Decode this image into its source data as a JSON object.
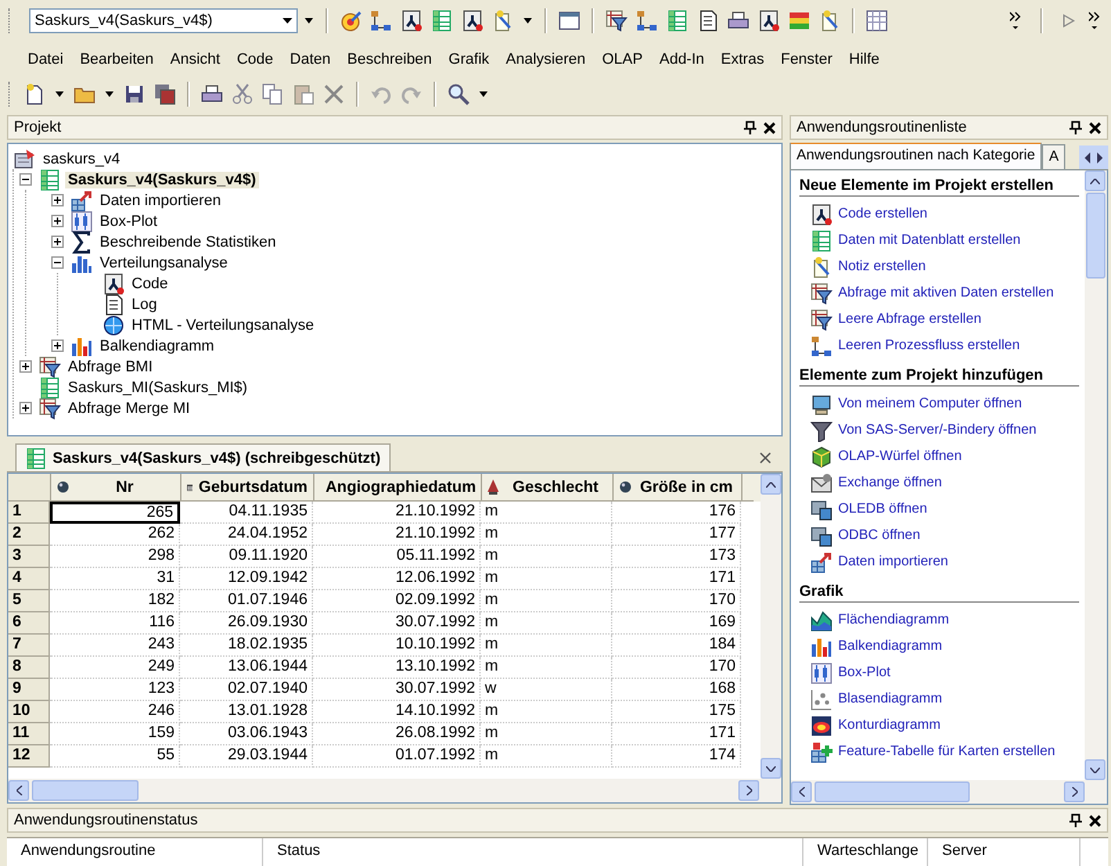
{
  "toolbar": {
    "dataset_selector": "Saskurs_v4(Saskurs_v4$)"
  },
  "menu": [
    "Datei",
    "Bearbeiten",
    "Ansicht",
    "Code",
    "Daten",
    "Beschreiben",
    "Grafik",
    "Analysieren",
    "OLAP",
    "Add-In",
    "Extras",
    "Fenster",
    "Hilfe"
  ],
  "project_panel": {
    "title": "Projekt",
    "tree": [
      {
        "label": "saskurs_v4",
        "kind": "project",
        "selected": false,
        "children": [
          {
            "label": "Saskurs_v4(Saskurs_v4$)",
            "kind": "data",
            "expanded": true,
            "selected": true,
            "children": [
              {
                "label": "Daten importieren",
                "kind": "import",
                "expanded": false,
                "selected": false
              },
              {
                "label": "Box-Plot",
                "kind": "boxplot",
                "expanded": false,
                "selected": false
              },
              {
                "label": "Beschreibende Statistiken",
                "kind": "sigma",
                "expanded": false,
                "selected": false
              },
              {
                "label": "Verteilungsanalyse",
                "kind": "histogram",
                "expanded": true,
                "selected": false,
                "children": [
                  {
                    "label": "Code",
                    "kind": "code",
                    "selected": false
                  },
                  {
                    "label": "Log",
                    "kind": "log",
                    "selected": false
                  },
                  {
                    "label": "HTML - Verteilungsanalyse",
                    "kind": "html",
                    "selected": false
                  }
                ]
              },
              {
                "label": "Balkendiagramm",
                "kind": "barchart",
                "expanded": false,
                "selected": false
              }
            ]
          },
          {
            "label": "Abfrage BMI",
            "kind": "query",
            "expanded": false,
            "selected": false
          },
          {
            "label": "Saskurs_MI(Saskurs_MI$)",
            "kind": "data",
            "selected": false
          },
          {
            "label": "Abfrage Merge MI",
            "kind": "query",
            "expanded": false,
            "selected": false
          }
        ]
      }
    ]
  },
  "data_view": {
    "tab": "Saskurs_v4(Saskurs_v4$) (schreibgeschützt)",
    "columns": [
      {
        "label": "Nr",
        "kind": "numeric"
      },
      {
        "label": "Geburtsdatum",
        "kind": "date"
      },
      {
        "label": "Angiographiedatum",
        "kind": "date"
      },
      {
        "label": "Geschlecht",
        "kind": "text"
      },
      {
        "label": "Größe in cm",
        "kind": "numeric"
      }
    ],
    "rows": [
      {
        "header": "1",
        "focused": true,
        "cells": [
          "265",
          "04.11.1935",
          "21.10.1992",
          "m",
          "176"
        ]
      },
      {
        "header": "2",
        "focused": false,
        "cells": [
          "262",
          "24.04.1952",
          "21.10.1992",
          "m",
          "177"
        ]
      },
      {
        "header": "3",
        "focused": false,
        "cells": [
          "298",
          "09.11.1920",
          "05.11.1992",
          "m",
          "173"
        ]
      },
      {
        "header": "4",
        "focused": false,
        "cells": [
          "31",
          "12.09.1942",
          "12.06.1992",
          "m",
          "171"
        ]
      },
      {
        "header": "5",
        "focused": false,
        "cells": [
          "182",
          "01.07.1946",
          "02.09.1992",
          "m",
          "170"
        ]
      },
      {
        "header": "6",
        "focused": false,
        "cells": [
          "116",
          "26.09.1930",
          "30.07.1992",
          "m",
          "169"
        ]
      },
      {
        "header": "7",
        "focused": false,
        "cells": [
          "243",
          "18.02.1935",
          "10.10.1992",
          "m",
          "184"
        ]
      },
      {
        "header": "8",
        "focused": false,
        "cells": [
          "249",
          "13.06.1944",
          "13.10.1992",
          "m",
          "170"
        ]
      },
      {
        "header": "9",
        "focused": false,
        "cells": [
          "123",
          "02.07.1940",
          "30.07.1992",
          "w",
          "168"
        ]
      },
      {
        "header": "10",
        "focused": false,
        "cells": [
          "246",
          "13.01.1928",
          "14.10.1992",
          "m",
          "175"
        ]
      },
      {
        "header": "11",
        "focused": false,
        "cells": [
          "159",
          "03.06.1943",
          "26.08.1992",
          "m",
          "171"
        ]
      },
      {
        "header": "12",
        "focused": false,
        "cells": [
          "55",
          "29.03.1944",
          "01.07.1992",
          "m",
          "174"
        ]
      }
    ]
  },
  "routines_panel": {
    "title": "Anwendungsroutinenliste",
    "tabs": [
      {
        "label": "Anwendungsroutinen nach Kategorie",
        "selected": true
      },
      {
        "label": "A",
        "selected": false
      }
    ],
    "sections": [
      {
        "title": "Neue Elemente im Projekt erstellen",
        "items": [
          {
            "label": "Code erstellen",
            "kind": "code"
          },
          {
            "label": "Daten mit Datenblatt erstellen",
            "kind": "data"
          },
          {
            "label": "Notiz erstellen",
            "kind": "note"
          },
          {
            "label": "Abfrage mit aktiven Daten erstellen",
            "kind": "query"
          },
          {
            "label": "Leere Abfrage erstellen",
            "kind": "query"
          },
          {
            "label": "Leeren Prozessfluss erstellen",
            "kind": "flow"
          }
        ]
      },
      {
        "title": "Elemente zum Projekt hinzufügen",
        "items": [
          {
            "label": "Von meinem Computer öffnen",
            "kind": "computer"
          },
          {
            "label": "Von SAS-Server/-Bindery öffnen",
            "kind": "funnel"
          },
          {
            "label": "OLAP-Würfel öffnen",
            "kind": "cube"
          },
          {
            "label": "Exchange öffnen",
            "kind": "exchange"
          },
          {
            "label": "OLEDB öffnen",
            "kind": "oledb"
          },
          {
            "label": "ODBC öffnen",
            "kind": "oledb"
          },
          {
            "label": "Daten importieren",
            "kind": "import"
          }
        ]
      },
      {
        "title": "Grafik",
        "items": [
          {
            "label": "Flächendiagramm",
            "kind": "area"
          },
          {
            "label": "Balkendiagramm",
            "kind": "barchart"
          },
          {
            "label": "Box-Plot",
            "kind": "boxplot"
          },
          {
            "label": "Blasendiagramm",
            "kind": "bubble"
          },
          {
            "label": "Konturdiagramm",
            "kind": "contour"
          },
          {
            "label": "Feature-Tabelle für Karten erstellen",
            "kind": "feature"
          }
        ]
      }
    ]
  },
  "status_panel": {
    "title": "Anwendungsroutinenstatus",
    "columns": [
      "Anwendungsroutine",
      "Status",
      "Warteschlange",
      "Server"
    ]
  }
}
